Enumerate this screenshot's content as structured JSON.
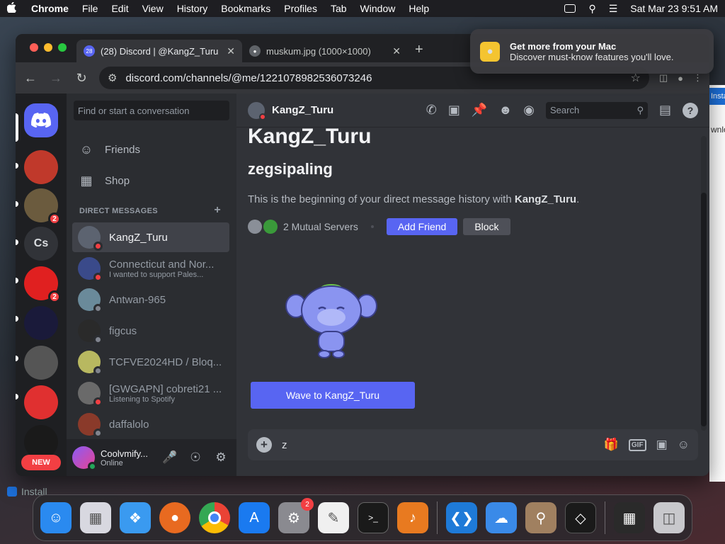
{
  "menubar": {
    "app": "Chrome",
    "items": [
      "File",
      "Edit",
      "View",
      "History",
      "Bookmarks",
      "Profiles",
      "Tab",
      "Window",
      "Help"
    ],
    "datetime": "Sat Mar 23  9:51 AM"
  },
  "browser": {
    "tabs": [
      {
        "title": "(28) Discord | @KangZ_Turu",
        "badge": "28"
      },
      {
        "title": "muskum.jpg (1000×1000)"
      }
    ],
    "url": "discord.com/channels/@me/1221078982536073246"
  },
  "notification": {
    "title": "Get more from your Mac",
    "body": "Discover must-know features you'll love."
  },
  "guilds": {
    "items": [
      {
        "id": "home",
        "color": "#5865f2",
        "icon": "discord-logo"
      },
      {
        "id": "g1",
        "color": "#c0392b"
      },
      {
        "id": "g2",
        "color": "#6b5b3e",
        "badge": "2"
      },
      {
        "id": "g3",
        "label": "Cs",
        "color": "#313338"
      },
      {
        "id": "g4",
        "color": "#e02020",
        "badge": "2"
      },
      {
        "id": "g5",
        "color": "#1a1a3a"
      },
      {
        "id": "g6",
        "color": "#555555"
      },
      {
        "id": "g7",
        "color": "#e03030"
      }
    ],
    "new_label": "NEW"
  },
  "sidebar": {
    "search_placeholder": "Find or start a conversation",
    "nav": [
      {
        "label": "Friends",
        "icon": "friends-icon"
      },
      {
        "label": "Shop",
        "icon": "shop-icon"
      }
    ],
    "dm_header": "DIRECT MESSAGES",
    "dms": [
      {
        "name": "KangZ_Turu",
        "sub": "",
        "status": "#f23f43",
        "color": "#5c6370",
        "selected": true
      },
      {
        "name": "Connecticut and Nor...",
        "sub": "I wanted to support Pales...",
        "status": "#f23f43",
        "color": "#3a4a8a"
      },
      {
        "name": "Antwan-965",
        "sub": "",
        "status": "#80848e",
        "color": "#6a8a9a"
      },
      {
        "name": "figcus",
        "sub": "",
        "status": "#80848e",
        "color": "#2a2a2a"
      },
      {
        "name": "TCFVE2024HD / Bloq...",
        "sub": "",
        "status": "#80848e",
        "color": "#b8b860"
      },
      {
        "name": "[GWGAPN] cobreti21 ...",
        "sub": "Listening to Spotify",
        "status": "#f23f43",
        "color": "#6a6a6a"
      },
      {
        "name": "daffalolo",
        "sub": "",
        "status": "#80848e",
        "color": "#8a3a2a"
      }
    ],
    "user": {
      "name": "Coolvmify...",
      "status": "Online"
    }
  },
  "channel": {
    "header_name": "KangZ_Turu",
    "search_label": "Search",
    "display_name": "KangZ_Turu",
    "username": "zegsipaling",
    "intro_prefix": "This is the beginning of your direct message history with ",
    "intro_name": "KangZ_Turu",
    "intro_suffix": ".",
    "mutual_servers": "2 Mutual Servers",
    "add_friend": "Add Friend",
    "block": "Block",
    "wave_button": "Wave to KangZ_Turu",
    "composer_value": "z"
  },
  "dock": {
    "apps": [
      {
        "name": "finder",
        "color": "#2a8af0"
      },
      {
        "name": "launchpad",
        "color": "#d8d8e0"
      },
      {
        "name": "safari",
        "color": "#3a9af0"
      },
      {
        "name": "firefox",
        "color": "#e86a20"
      },
      {
        "name": "chrome",
        "color": "#e8e8e8"
      },
      {
        "name": "app-store",
        "color": "#1a7af0"
      },
      {
        "name": "system-settings",
        "color": "#8a8a90",
        "badge": "2"
      },
      {
        "name": "textedit",
        "color": "#f0f0f0"
      },
      {
        "name": "terminal",
        "color": "#1a1a1a"
      },
      {
        "name": "garageband",
        "color": "#e87a20"
      },
      {
        "name": "vscode",
        "color": "#1e7ad8"
      },
      {
        "name": "weather",
        "color": "#3a8ae8"
      },
      {
        "name": "utility",
        "color": "#a08060"
      },
      {
        "name": "cursor",
        "color": "#1a1a1a"
      },
      {
        "name": "downloads",
        "color": "#2a2a2a"
      },
      {
        "name": "trash",
        "color": "#c8c8cc"
      }
    ]
  },
  "background": {
    "install_label": "Install",
    "side_button": "Insta",
    "side_text": "wnlo"
  }
}
